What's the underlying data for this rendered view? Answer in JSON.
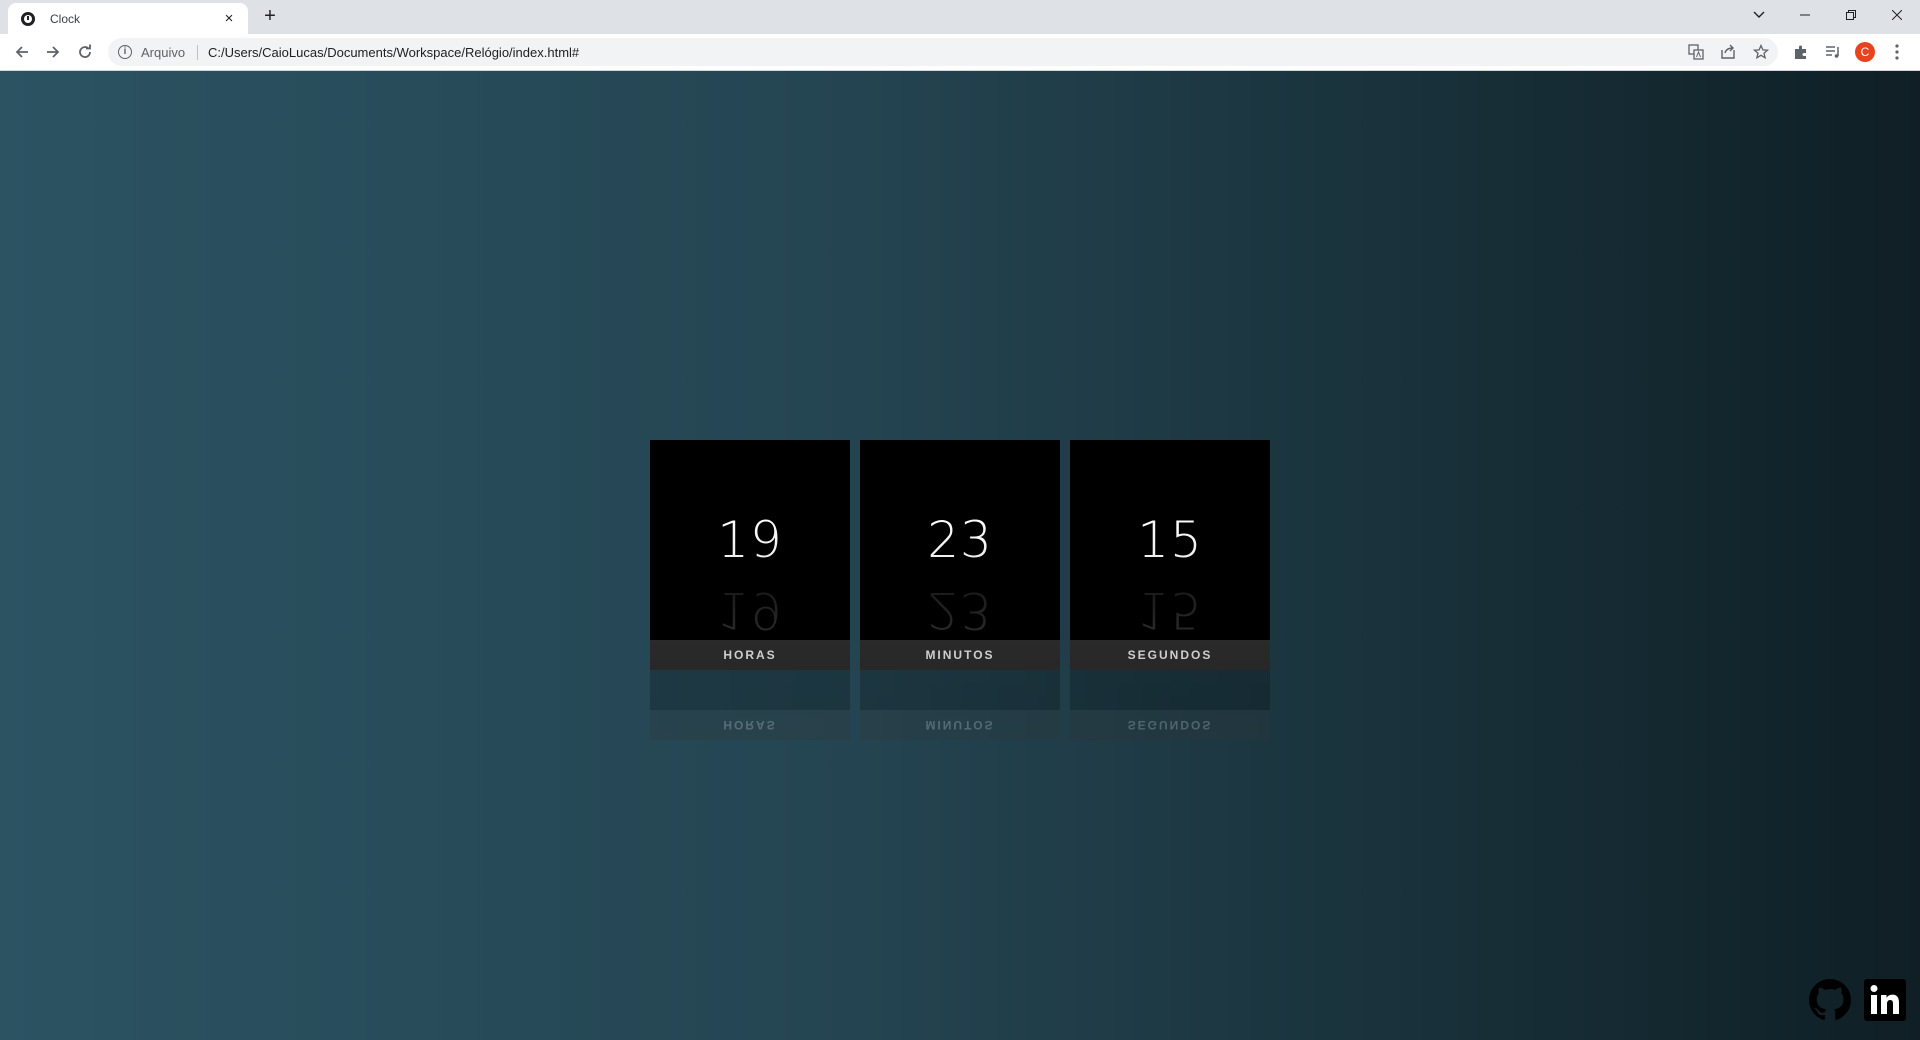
{
  "browser": {
    "tab_title": "Clock",
    "tab_close": "×",
    "new_tab": "+",
    "security_label": "Arquivo",
    "url": "C:/Users/CaioLucas/Documents/Workspace/Relógio/index.html#",
    "profile_initial": "C",
    "profile_color": "#e8431f"
  },
  "clock": {
    "units": [
      {
        "value": "19",
        "label": "HORAS"
      },
      {
        "value": "23",
        "label": "MINUTOS"
      },
      {
        "value": "15",
        "label": "SEGUNDOS"
      }
    ]
  },
  "icons": {
    "github": "github-icon",
    "linkedin": "linkedin-icon"
  },
  "colors": {
    "background_left": "#2b5362",
    "background_right": "#0f1f25",
    "digit_box": "#000000",
    "label_box": "#333333"
  }
}
